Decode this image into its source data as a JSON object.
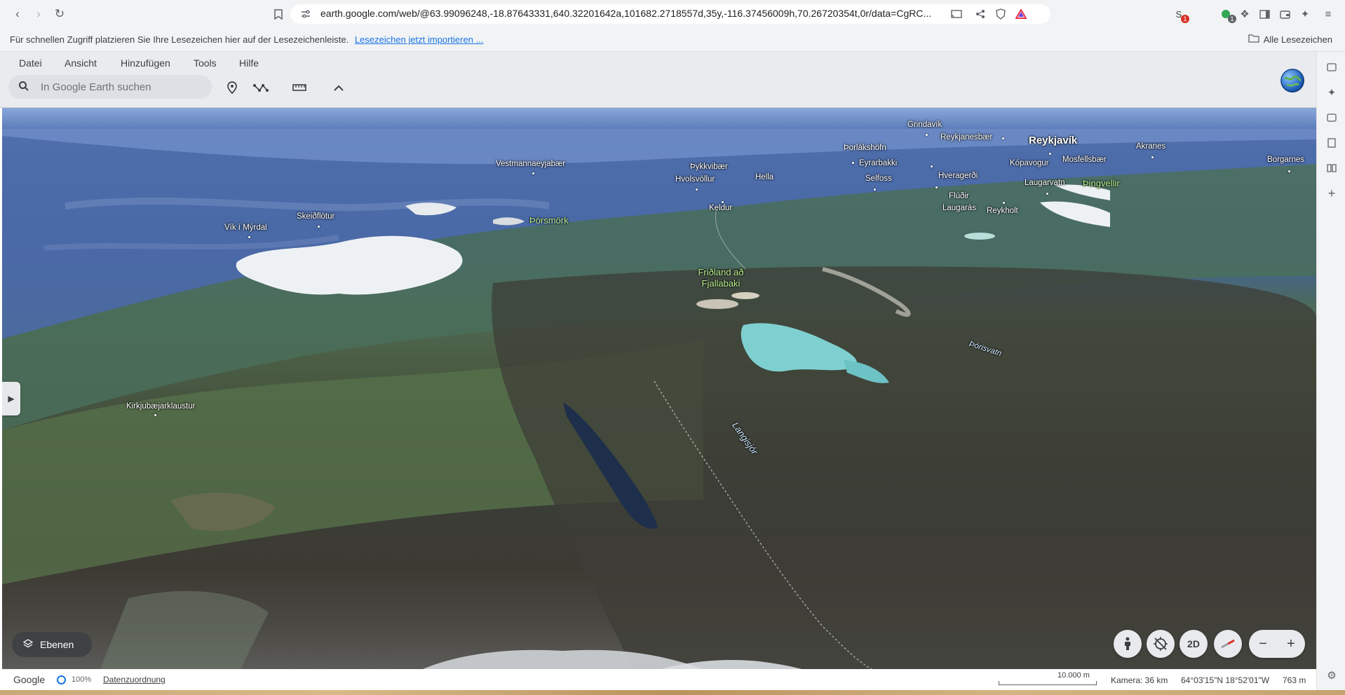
{
  "browser": {
    "url": "earth.google.com/web/@63.99096248,-18.87643331,640.32201642a,101682.2718557d,35y,-116.37456009h,70.26720354t,0r/data=CgRC...",
    "extension_badges": [
      "1",
      "1"
    ]
  },
  "bookmarks": {
    "hint": "Für schnellen Zugriff platzieren Sie Ihre Lesezeichen hier auf der Lesezeichenleiste.",
    "import_link": "Lesezeichen jetzt importieren ...",
    "all_bookmarks": "Alle Lesezeichen"
  },
  "menu": [
    "Datei",
    "Ansicht",
    "Hinzufügen",
    "Tools",
    "Hilfe"
  ],
  "search": {
    "placeholder": "In Google Earth suchen"
  },
  "map_labels": [
    {
      "text": "Grindavík",
      "kind": "town"
    },
    {
      "text": "Reykjanesbær",
      "kind": "town"
    },
    {
      "text": "Reykjavík",
      "kind": "city"
    },
    {
      "text": "Þorlákshöfn",
      "kind": "town"
    },
    {
      "text": "Akranes",
      "kind": "town"
    },
    {
      "text": "Borgarnes",
      "kind": "town"
    },
    {
      "text": "Vestmannaeyjabær",
      "kind": "town"
    },
    {
      "text": "Þykkvibær",
      "kind": "town"
    },
    {
      "text": "Eyrarbakki",
      "kind": "town"
    },
    {
      "text": "Kópavogur",
      "kind": "town"
    },
    {
      "text": "Mosfellsbær",
      "kind": "town"
    },
    {
      "text": "Hvolsvöllur",
      "kind": "town"
    },
    {
      "text": "Hella",
      "kind": "town"
    },
    {
      "text": "Hveragerði",
      "kind": "town"
    },
    {
      "text": "Selfoss",
      "kind": "town"
    },
    {
      "text": "Laugarvatn",
      "kind": "town"
    },
    {
      "text": "Þingvellir",
      "kind": "park"
    },
    {
      "text": "Flúðir",
      "kind": "town"
    },
    {
      "text": "Laugarás",
      "kind": "town"
    },
    {
      "text": "Reykholt",
      "kind": "town"
    },
    {
      "text": "Keldur",
      "kind": "town"
    },
    {
      "text": "Skeiðflötur",
      "kind": "town"
    },
    {
      "text": "Vík í Mýrdal",
      "kind": "town"
    },
    {
      "text": "Þórsmörk",
      "kind": "park"
    },
    {
      "text": "Friðland að Fjallabaki",
      "kind": "park"
    },
    {
      "text": "Þórisvatn",
      "kind": "water"
    },
    {
      "text": "Langisjór",
      "kind": "water"
    },
    {
      "text": "Kirkjubæjarklaustur",
      "kind": "town"
    }
  ],
  "controls": {
    "layers": "Ebenen",
    "view_2d": "2D"
  },
  "status": {
    "brand": "Google",
    "loading": "100%",
    "attribution": "Datenzuordnung",
    "scale": "10.000 m",
    "camera": "Kamera: 36 km",
    "coordinates": "64°03'15\"N 18°52'01\"W",
    "elevation": "763 m"
  },
  "colors": {
    "accent": "#1a73e8",
    "header_bg": "#e9ebee",
    "toolbar_bg": "#f1f3f4"
  }
}
